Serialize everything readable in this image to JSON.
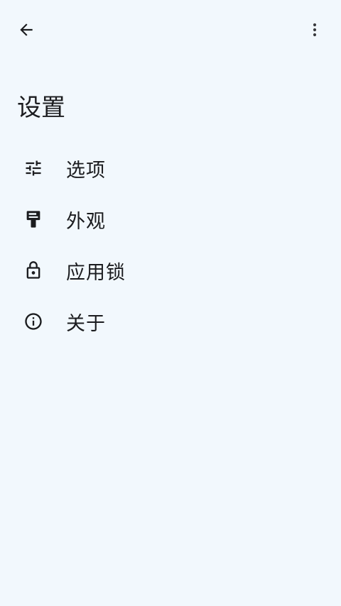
{
  "app": {
    "background": "#f2f8fd",
    "text_color": "#1b1c1f"
  },
  "top_bar": {
    "back_icon": "arrow-back-icon",
    "more_icon": "more-vert-icon"
  },
  "page": {
    "title": "设置"
  },
  "menu": {
    "items": [
      {
        "label": "选项",
        "icon": "tune-sliders-icon"
      },
      {
        "label": "外观",
        "icon": "paint-roller-icon"
      },
      {
        "label": "应用锁",
        "icon": "lock-icon"
      },
      {
        "label": "关于",
        "icon": "info-icon"
      }
    ]
  }
}
